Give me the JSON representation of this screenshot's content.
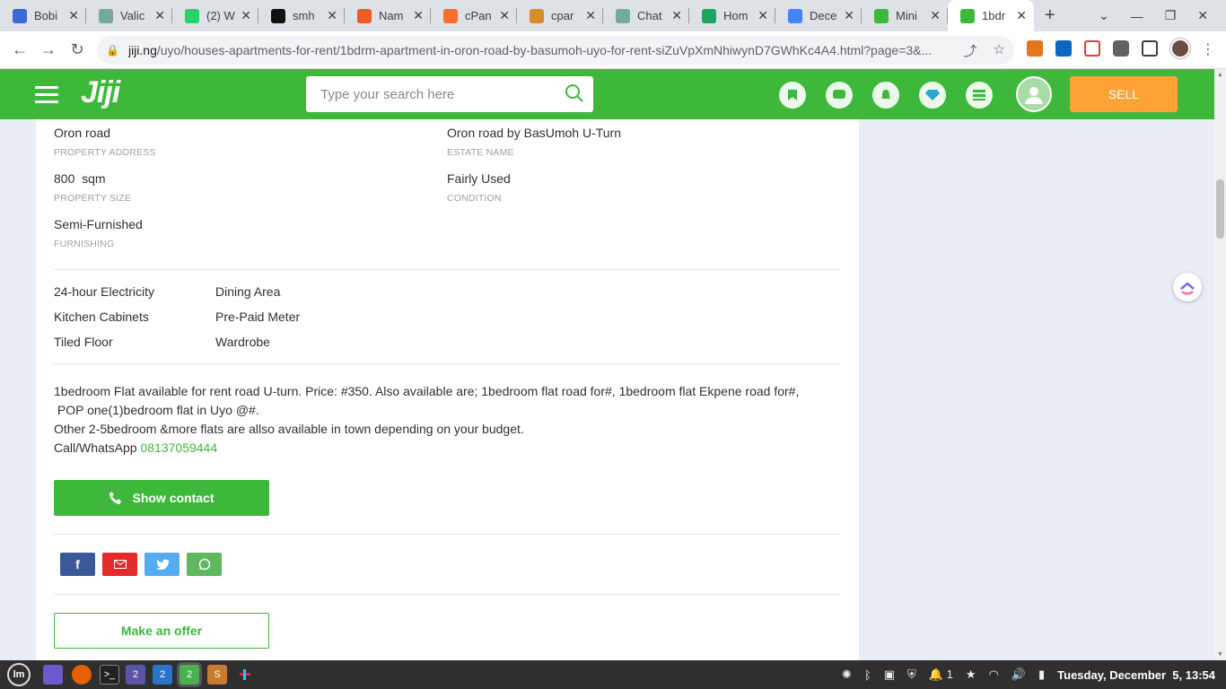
{
  "browser": {
    "tabs": [
      {
        "title": "Bobi",
        "color": "#3b6ad6"
      },
      {
        "title": "Valic",
        "color": "#74aa9c"
      },
      {
        "title": "(2) W",
        "color": "#25d366"
      },
      {
        "title": "smh",
        "color": "#111111"
      },
      {
        "title": "Nam",
        "color": "#f15a24"
      },
      {
        "title": "cPan",
        "color": "#ff6c2c"
      },
      {
        "title": "cpar",
        "color": "#d98b2b"
      },
      {
        "title": "Chat",
        "color": "#74aa9c"
      },
      {
        "title": "Hom",
        "color": "#1fa463"
      },
      {
        "title": "Dece",
        "color": "#4285f4"
      },
      {
        "title": "Mini",
        "color": "#3db83a"
      },
      {
        "title": "1bdr",
        "color": "#3db83a",
        "active": true
      }
    ],
    "url_host": "jiji.ng",
    "url_rest": "/uyo/houses-apartments-for-rent/1bdrm-apartment-in-oron-road-by-basumoh-uyo-for-rent-siZuVpXmNhiwynD7GWhKc4A4.html?page=3&..."
  },
  "header": {
    "logo": "Jiji",
    "search_placeholder": "Type your search here",
    "sell_label": "SELL"
  },
  "attributes": [
    {
      "value": "Oron road",
      "label": "PROPERTY ADDRESS"
    },
    {
      "value": "Oron road by BasUmoh U-Turn",
      "label": "ESTATE NAME"
    },
    {
      "value": "800  sqm",
      "label": "PROPERTY SIZE"
    },
    {
      "value": "Fairly Used",
      "label": "CONDITION"
    },
    {
      "value": "Semi-Furnished",
      "label": "FURNISHING"
    }
  ],
  "features": [
    "24-hour Electricity",
    "Dining Area",
    "Kitchen Cabinets",
    "Pre-Paid Meter",
    "Tiled Floor",
    "Wardrobe"
  ],
  "description": {
    "line1": "1bedroom Flat available for rent road U-turn. Price: #350. Also available are; 1bedroom flat road for#, 1bedroom flat Ekpene road for#,",
    "line2": " POP one(1)bedroom flat in Uyo @#.",
    "line3": "Other 2-5bedroom &more flats are allso available in town depending on your budget.",
    "line4_prefix": "Call/WhatsApp ",
    "phone": "08137059444"
  },
  "actions": {
    "show_contact": "Show contact",
    "make_offer": "Make an offer"
  },
  "taskbar": {
    "workspace_badges": [
      "2",
      "2",
      "2"
    ],
    "tray_count": "1",
    "clock": "Tuesday, December  5, 13:54"
  },
  "colors": {
    "brand_green": "#3db83a",
    "sell_orange": "#fda235",
    "facebook": "#3b5998",
    "email": "#e32b2b",
    "twitter": "#55acee",
    "whatsapp": "#5fb760"
  }
}
